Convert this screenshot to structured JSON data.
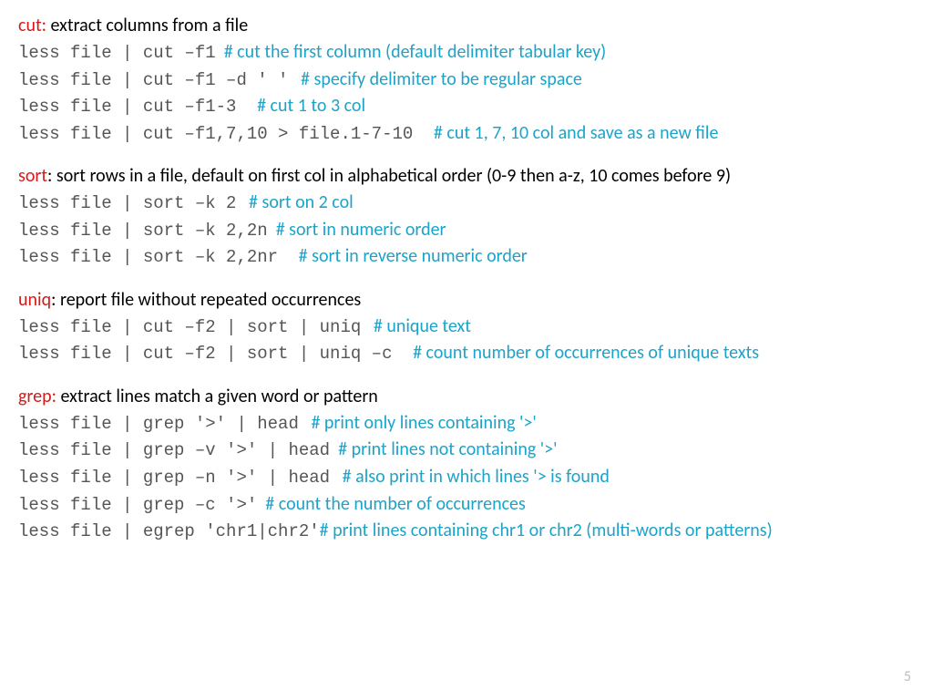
{
  "page_number": "5",
  "sections": {
    "cut": {
      "cmd": "cut:",
      "desc": " extract columns from a file",
      "lines": [
        {
          "code": "less file | cut –f1",
          "comment": "# cut the first column (default delimiter tabular key)"
        },
        {
          "code": "less file | cut –f1 –d ' '",
          "comment": "# specify delimiter to be regular space"
        },
        {
          "code": "less file | cut –f1-3",
          "comment": "# cut 1 to 3 col"
        },
        {
          "code": "less file | cut –f1,7,10 > file.1-7-10",
          "comment": "# cut 1, 7, 10 col and save as a new file"
        }
      ]
    },
    "sort": {
      "cmd": "sort",
      "desc": ": sort rows in a file, default on first col in alphabetical order (0-9 then a-z, 10 comes before 9)",
      "lines": [
        {
          "code": "less file | sort –k 2",
          "comment": "# sort on 2 col"
        },
        {
          "code": "less file | sort –k 2,2n",
          "comment": "# sort in numeric order"
        },
        {
          "code": "less file | sort –k 2,2nr",
          "comment": "# sort in reverse numeric order"
        }
      ]
    },
    "uniq": {
      "cmd": "uniq",
      "desc": ": report file without repeated occurrences",
      "lines": [
        {
          "code": "less file | cut –f2 | sort | uniq",
          "comment": "# unique text"
        },
        {
          "code": "less file | cut –f2 | sort | uniq –c",
          "comment": "#  count number of occurrences of unique texts"
        }
      ]
    },
    "grep": {
      "cmd": "grep:",
      "desc": " extract lines match a given word or pattern",
      "lines": [
        {
          "code": "less file | grep '>' | head",
          "comment": "#  print only lines containing '>'"
        },
        {
          "code": "less file | grep –v '>' | head",
          "comment": "# print lines not containing '>'"
        },
        {
          "code": "less file | grep –n '>' | head",
          "comment": "# also print in which lines '> is found"
        },
        {
          "code": "less file | grep –c '>'",
          "comment": "# count the number of occurrences"
        },
        {
          "code": "less file | egrep 'chr1|chr2'",
          "comment": "# print lines containing chr1 or  chr2 (multi-words or patterns)"
        }
      ]
    }
  }
}
